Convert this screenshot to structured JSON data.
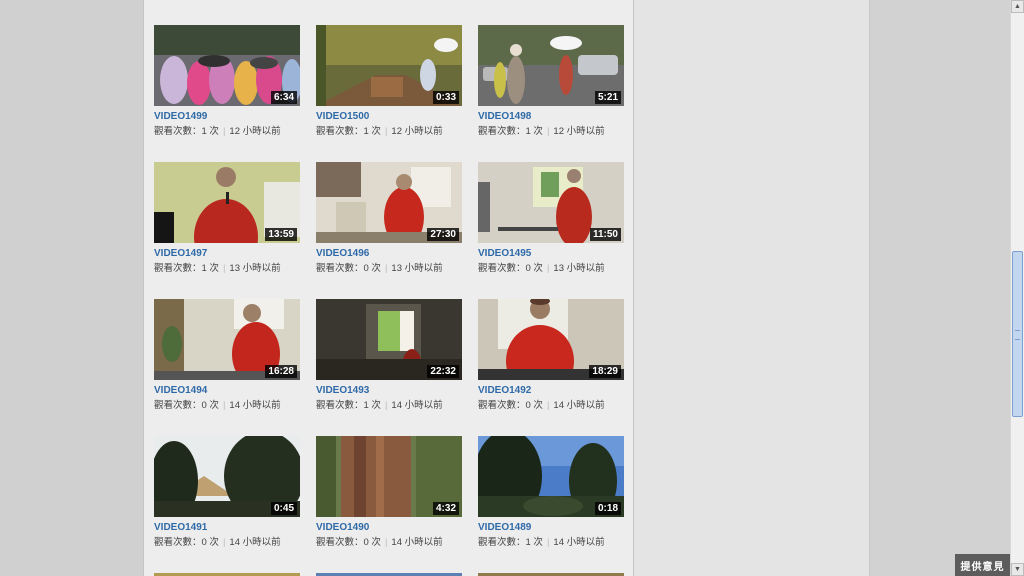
{
  "videos": [
    {
      "title": "VIDEO1499",
      "duration": "6:34",
      "views_label": "觀看次數：1 次",
      "age": "12 小時以前",
      "scene": "crowd-raincoats"
    },
    {
      "title": "VIDEO1500",
      "duration": "0:33",
      "views_label": "觀看次數：1 次",
      "age": "12 小時以前",
      "scene": "forest-path"
    },
    {
      "title": "VIDEO1498",
      "duration": "5:21",
      "views_label": "觀看次數：1 次",
      "age": "12 小時以前",
      "scene": "parking-lot"
    },
    {
      "title": "VIDEO1497",
      "duration": "13:59",
      "views_label": "觀看次數：1 次",
      "age": "13 小時以前",
      "scene": "speaker-closeup"
    },
    {
      "title": "VIDEO1496",
      "duration": "27:30",
      "views_label": "觀看次數：0 次",
      "age": "13 小時以前",
      "scene": "speaker-room"
    },
    {
      "title": "VIDEO1495",
      "duration": "11:50",
      "views_label": "觀看次數：0 次",
      "age": "13 小時以前",
      "scene": "speaker-screen"
    },
    {
      "title": "VIDEO1494",
      "duration": "16:28",
      "views_label": "觀看次數：0 次",
      "age": "14 小時以前",
      "scene": "speaker-plant"
    },
    {
      "title": "VIDEO1493",
      "duration": "22:32",
      "views_label": "觀看次數：1 次",
      "age": "14 小時以前",
      "scene": "dark-projector"
    },
    {
      "title": "VIDEO1492",
      "duration": "18:29",
      "views_label": "觀看次數：0 次",
      "age": "14 小時以前",
      "scene": "speaker-cap"
    },
    {
      "title": "VIDEO1491",
      "duration": "0:45",
      "views_label": "觀看次數：0 次",
      "age": "14 小時以前",
      "scene": "trees-mountain"
    },
    {
      "title": "VIDEO1490",
      "duration": "4:32",
      "views_label": "觀看次數：0 次",
      "age": "14 小時以前",
      "scene": "tree-trunk"
    },
    {
      "title": "VIDEO1489",
      "duration": "0:18",
      "views_label": "觀看次數：1 次",
      "age": "14 小時以前",
      "scene": "blue-sky-trees"
    }
  ],
  "feedback_label": "提供意見",
  "colors": {
    "link": "#2f6aa8",
    "panel": "#ededed",
    "background": "#cfcfcf",
    "scroll_thumb": "#c2d6ef"
  },
  "icons": {
    "scroll_up": "scroll-up-arrow-icon",
    "scroll_down": "scroll-down-arrow-icon"
  }
}
